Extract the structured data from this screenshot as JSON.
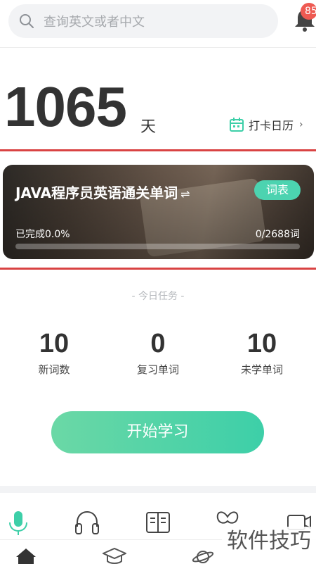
{
  "search": {
    "placeholder": "查询英文或者中文",
    "icon": "search-icon"
  },
  "notifications": {
    "badge": "85",
    "icon": "bell-icon"
  },
  "streak": {
    "days": "1065",
    "unit": "天"
  },
  "checkin": {
    "label": "打卡日历",
    "icon": "calendar-icon",
    "chevron": "›"
  },
  "book": {
    "title": "JAVA程序员英语通关单词",
    "swap_icon": "⇌",
    "wordlist_label": "词表",
    "progress_label": "已完成0.0%",
    "progress_count": "0/2688词",
    "progress_fraction": 0.0
  },
  "today": {
    "label": "- 今日任务 -"
  },
  "stats": [
    {
      "value": "10",
      "label": "新词数"
    },
    {
      "value": "0",
      "label": "复习单词"
    },
    {
      "value": "10",
      "label": "未学单词"
    }
  ],
  "start_button": {
    "label": "开始学习"
  },
  "tools": [
    "microphone-icon",
    "headphones-icon",
    "book-open-icon",
    "butterfly-icon",
    "video-icon"
  ],
  "tabs": [
    "home-icon",
    "graduation-cap-icon",
    "planet-icon"
  ],
  "watermark": "软件技巧",
  "colors": {
    "accent": "#4cd3b0",
    "badge": "#ee5a52",
    "highlight": "#d94343"
  }
}
